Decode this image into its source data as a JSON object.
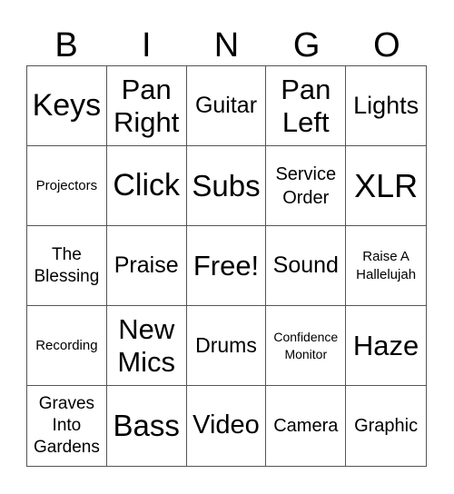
{
  "header": [
    "B",
    "I",
    "N",
    "G",
    "O"
  ],
  "cells": [
    "Keys",
    "Pan Right",
    "Guitar",
    "Pan Left",
    "Lights",
    "Projectors",
    "Click",
    "Subs",
    "Service Order",
    "XLR",
    "The Blessing",
    "Praise",
    "Free!",
    "Sound",
    "Raise A Hallelujah",
    "Recording",
    "New Mics",
    "Drums",
    "Confidence Monitor",
    "Haze",
    "Graves Into Gardens",
    "Bass",
    "Video",
    "Camera",
    "Graphic"
  ]
}
